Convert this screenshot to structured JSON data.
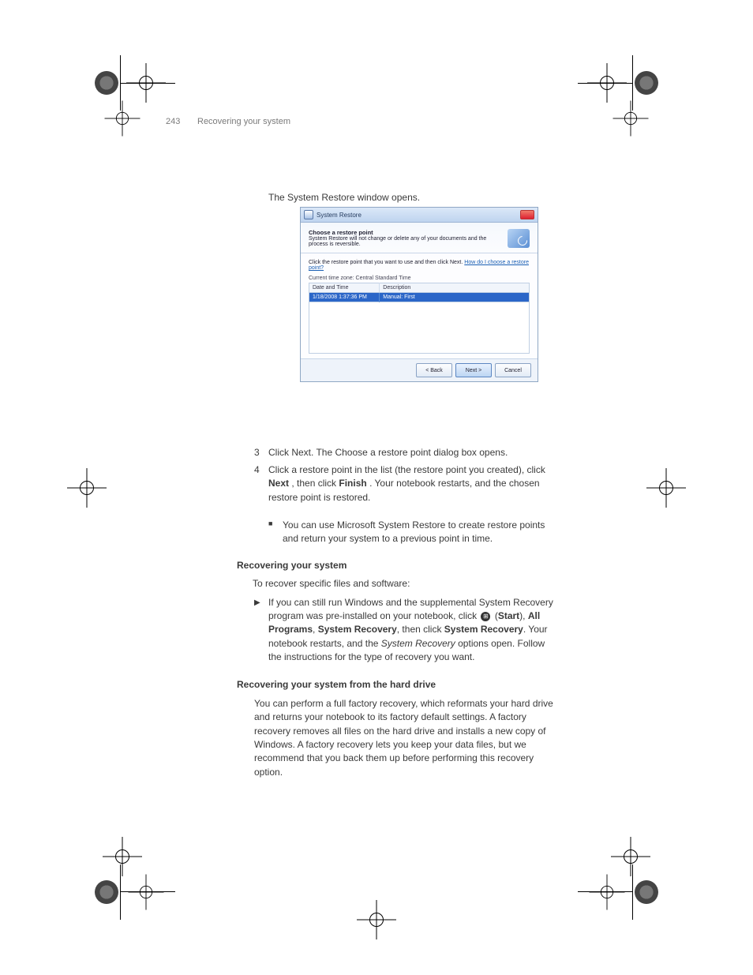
{
  "page": {
    "number": "243",
    "chapter": "Recovering your system"
  },
  "lead": {
    "p1": "The System Restore window opens."
  },
  "dialog": {
    "title": "System Restore",
    "heading": "Choose a restore point",
    "subheading": "System Restore will not change or delete any of your documents and the process is reversible.",
    "instruction_a": "Click the restore point that you want to use and then click Next. ",
    "instruction_link": "How do I choose a restore point?",
    "timezone": "Current time zone: Central Standard Time",
    "col_date": "Date and Time",
    "col_desc": "Description",
    "row_date": "1/18/2008 1:37:36 PM",
    "row_desc": "Manual: First",
    "btn_back": "< Back",
    "btn_next": "Next >",
    "btn_cancel": "Cancel"
  },
  "steps": {
    "s3_num": "3",
    "s3_txt": "Click Next. The Choose a restore point dialog box opens.",
    "s4_num": "4",
    "s4_txt_a": "Click a restore point in the list (the restore point you created), click ",
    "s4_txt_b": ", then click ",
    "s4_txt_c": ". Your notebook restarts, and the chosen restore point is restored.",
    "next_label": "Next",
    "finish_label": "Finish"
  },
  "bullet": {
    "text": "You can use Microsoft System Restore to create restore points and return your system to a previous point in time."
  },
  "recover_heading": "Recovering your system",
  "recover_lead": "To recover specific files and software:",
  "recover_step": "If you can still run Windows and the supplemental System Recovery program was pre-installed on your notebook, click  (Start), All Programs, System Recovery, then click System Recovery. Your notebook restarts, and the System Recovery options open. Follow the instructions for the type of recovery you want.",
  "factory_heading": "Recovering your system from the hard drive",
  "factory_para": "You can perform a full factory recovery, which reformats your hard drive and returns your notebook to its factory default settings. A factory recovery removes all files on the hard drive and installs a new copy of Windows. A factory recovery lets you keep your data files, but we recommend that you back them up before performing this recovery option."
}
